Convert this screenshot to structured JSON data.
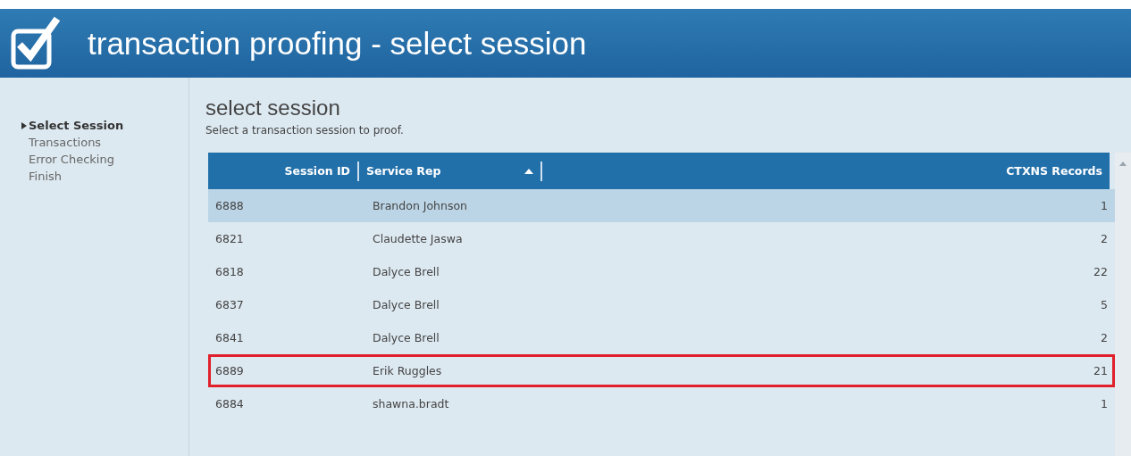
{
  "header": {
    "title": "transaction proofing - select session"
  },
  "sidebar": {
    "items": [
      {
        "label": "Select Session",
        "selected": true
      },
      {
        "label": "Transactions",
        "selected": false
      },
      {
        "label": "Error Checking",
        "selected": false
      },
      {
        "label": "Finish",
        "selected": false
      }
    ]
  },
  "content": {
    "title": "select session",
    "subtitle": "Select a transaction session to proof."
  },
  "table": {
    "columns": [
      {
        "label": "Session ID",
        "sorted": false
      },
      {
        "label": "Service Rep",
        "sorted": true
      },
      {
        "label": "CTXNS Records",
        "sorted": false
      }
    ],
    "rows": [
      {
        "cells": [
          "6888",
          "Brandon Johnson",
          "1"
        ],
        "selected": true,
        "highlighted": false
      },
      {
        "cells": [
          "6821",
          "Claudette Jaswa",
          "2"
        ],
        "selected": false,
        "highlighted": false
      },
      {
        "cells": [
          "6818",
          "Dalyce Brell",
          "22"
        ],
        "selected": false,
        "highlighted": false
      },
      {
        "cells": [
          "6837",
          "Dalyce Brell",
          "5"
        ],
        "selected": false,
        "highlighted": false
      },
      {
        "cells": [
          "6841",
          "Dalyce Brell",
          "2"
        ],
        "selected": false,
        "highlighted": false
      },
      {
        "cells": [
          "6889",
          "Erik Ruggles",
          "21"
        ],
        "selected": false,
        "highlighted": true
      },
      {
        "cells": [
          "6884",
          "shawna.bradt",
          "1"
        ],
        "selected": false,
        "highlighted": false
      }
    ]
  }
}
